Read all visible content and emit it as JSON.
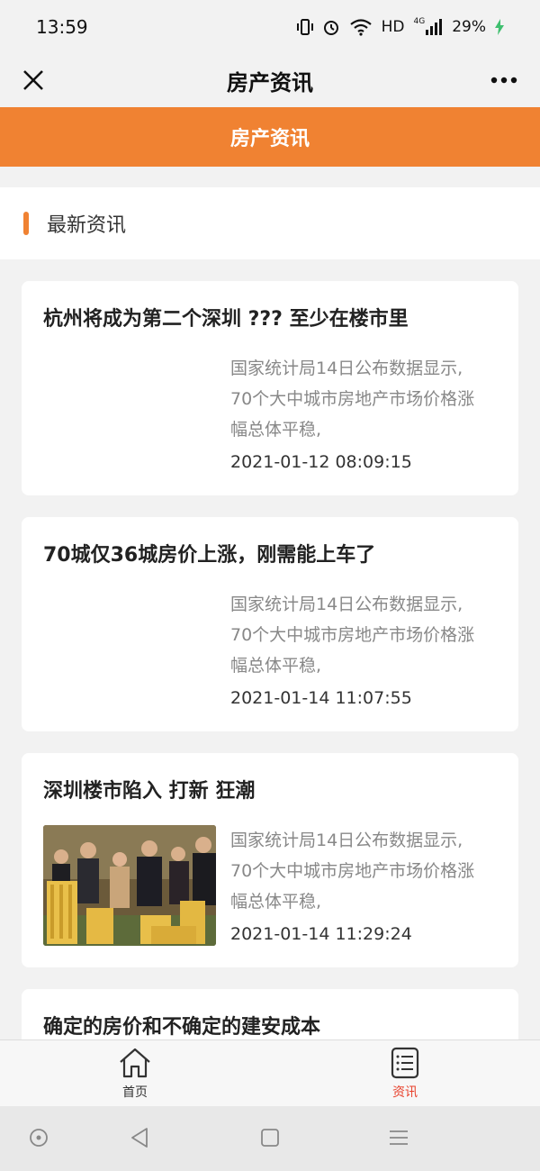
{
  "status_bar": {
    "time": "13:59",
    "network": "HD",
    "signal_label": "4G",
    "battery": "29%"
  },
  "title_bar": {
    "title": "房产资讯",
    "close_icon": "close-icon",
    "more_icon": "more-icon"
  },
  "header": {
    "title": "房产资讯",
    "accent_color": "#f08232"
  },
  "section": {
    "title": "最新资讯"
  },
  "articles": [
    {
      "title": "杭州将成为第二个深圳 ??? 至少在楼市里",
      "summary_lines": [
        "国家统计局14日公布数据显示,",
        "70个大中城市房地产市场价格涨",
        "幅总体平稳,"
      ],
      "date": "2021-01-12 08:09:15",
      "has_image": false
    },
    {
      "title": "70城仅36城房价上涨，刚需能上车了",
      "summary_lines": [
        "国家统计局14日公布数据显示,",
        "70个大中城市房地产市场价格涨",
        "幅总体平稳,"
      ],
      "date": "2021-01-14 11:07:55",
      "has_image": false
    },
    {
      "title": "深圳楼市陷入 打新 狂潮",
      "summary_lines": [
        "国家统计局14日公布数据显示,",
        "70个大中城市房地产市场价格涨",
        "幅总体平稳,"
      ],
      "date": "2021-01-14 11:29:24",
      "has_image": true
    },
    {
      "title": "确定的房价和不确定的建安成本"
    }
  ],
  "tabs": [
    {
      "label": "首页",
      "icon": "home-icon",
      "active": false
    },
    {
      "label": "资讯",
      "icon": "news-list-icon",
      "active": true
    }
  ],
  "nav_bar": {
    "icons": [
      "circle-icon",
      "back-triangle-icon",
      "square-icon",
      "menu-lines-icon"
    ]
  }
}
